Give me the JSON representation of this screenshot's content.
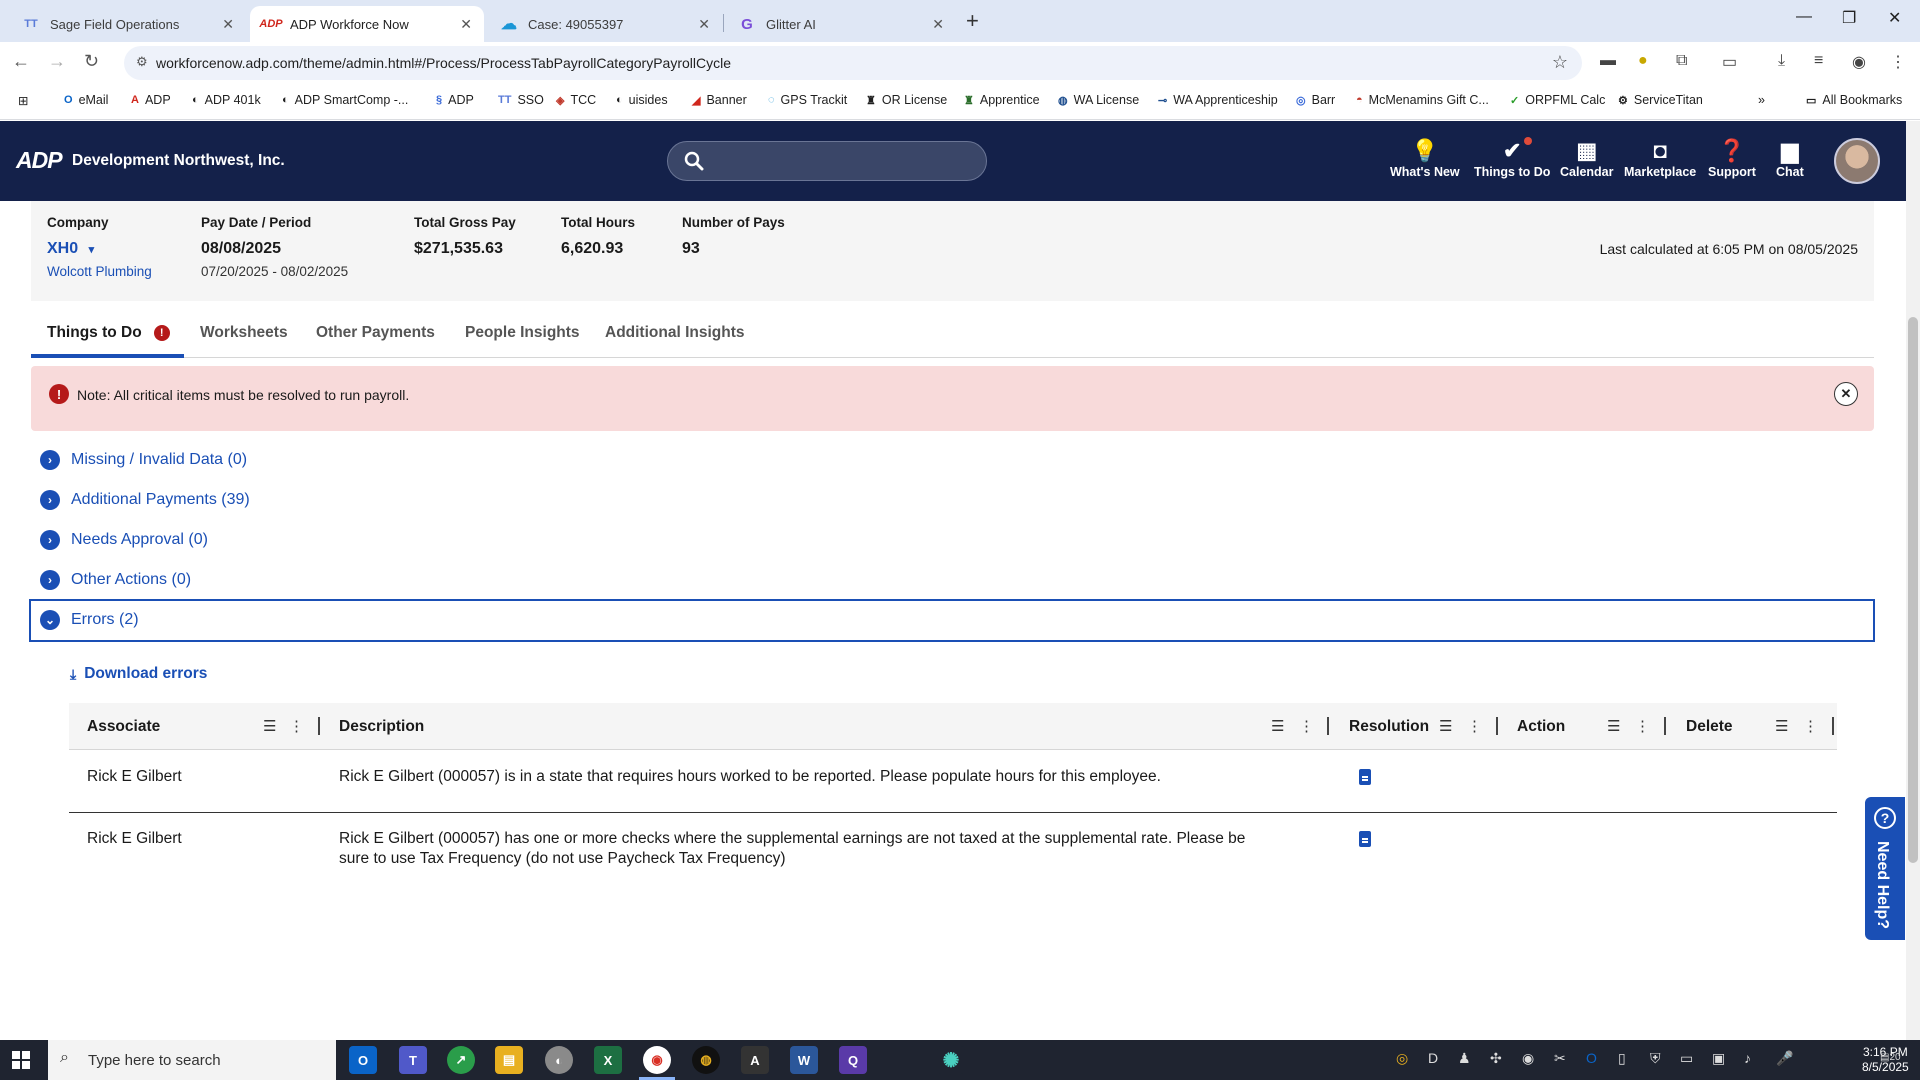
{
  "browser": {
    "tabs": [
      {
        "label": "Sage Field Operations",
        "icon": "TT"
      },
      {
        "label": "ADP Workforce Now",
        "icon": "ADP"
      },
      {
        "label": "Case: 49055397",
        "icon": "cloud"
      },
      {
        "label": "Glitter AI",
        "icon": "G"
      }
    ],
    "url": "workforcenow.adp.com/theme/admin.html#/Process/ProcessTabPayrollCategoryPayrollCycle",
    "bookmarks": [
      "eMail",
      "ADP",
      "ADP 401k",
      "ADP SmartComp -...",
      "ADP",
      "SSO",
      "TCC",
      "uisides",
      "Banner",
      "GPS Trackit",
      "OR License",
      "Apprentice",
      "WA License",
      "WA Apprenticeship",
      "Barr",
      "McMenamins Gift C...",
      "ORPFML Calc",
      "ServiceTitan"
    ],
    "all_bookmarks": "All Bookmarks"
  },
  "header": {
    "logo": "ADP",
    "company": "Development Northwest, Inc.",
    "nav": [
      {
        "label": "What's New",
        "icon": "lightbulb-icon"
      },
      {
        "label": "Things to Do",
        "icon": "check-circle-icon"
      },
      {
        "label": "Calendar",
        "icon": "calendar-icon"
      },
      {
        "label": "Marketplace",
        "icon": "shopping-bag-icon"
      },
      {
        "label": "Support",
        "icon": "help-icon"
      },
      {
        "label": "Chat",
        "icon": "chat-icon"
      }
    ]
  },
  "summary": {
    "company_label": "Company",
    "company_code": "XH0",
    "company_name": "Wolcott Plumbing",
    "pay_label": "Pay Date / Period",
    "pay_date": "08/08/2025",
    "pay_period": "07/20/2025 - 08/02/2025",
    "gross_label": "Total Gross Pay",
    "gross_value": "$271,535.63",
    "hours_label": "Total Hours",
    "hours_value": "6,620.93",
    "pays_label": "Number of Pays",
    "pays_value": "93",
    "last_calculated": "Last calculated at 6:05 PM on 08/05/2025"
  },
  "tabs": [
    "Things to Do",
    "Worksheets",
    "Other Payments",
    "People Insights",
    "Additional Insights"
  ],
  "alert": {
    "text": "Note: All critical items must be resolved to run payroll."
  },
  "sections": [
    "Missing / Invalid Data (0)",
    "Additional Payments (39)",
    "Needs Approval (0)",
    "Other Actions (0)",
    "Errors (2)"
  ],
  "download_label": "Download errors",
  "grid": {
    "columns": [
      "Associate",
      "Description",
      "Resolution",
      "Action",
      "Delete"
    ],
    "rows": [
      {
        "associate": "Rick E Gilbert",
        "description": "Rick E Gilbert (000057) is in a state that requires hours worked to be reported. Please populate hours for this employee."
      },
      {
        "associate": "Rick E Gilbert",
        "description_1": "Rick E Gilbert (000057) has one or more checks where the supplemental earnings are not taxed at the supplemental rate. Please be",
        "description_2": "sure to use Tax Frequency (do not use Paycheck Tax Frequency)"
      }
    ]
  },
  "need_help": "Need Help?",
  "taskbar": {
    "search_placeholder": "Type here to search",
    "time": "3:16 PM",
    "date": "8/5/2025",
    "notifications": "20"
  },
  "colors": {
    "header_bg": "#14214a",
    "link_blue": "#1a4fb5",
    "alert_bg": "#f8dada",
    "error_red": "#b51a1a"
  }
}
